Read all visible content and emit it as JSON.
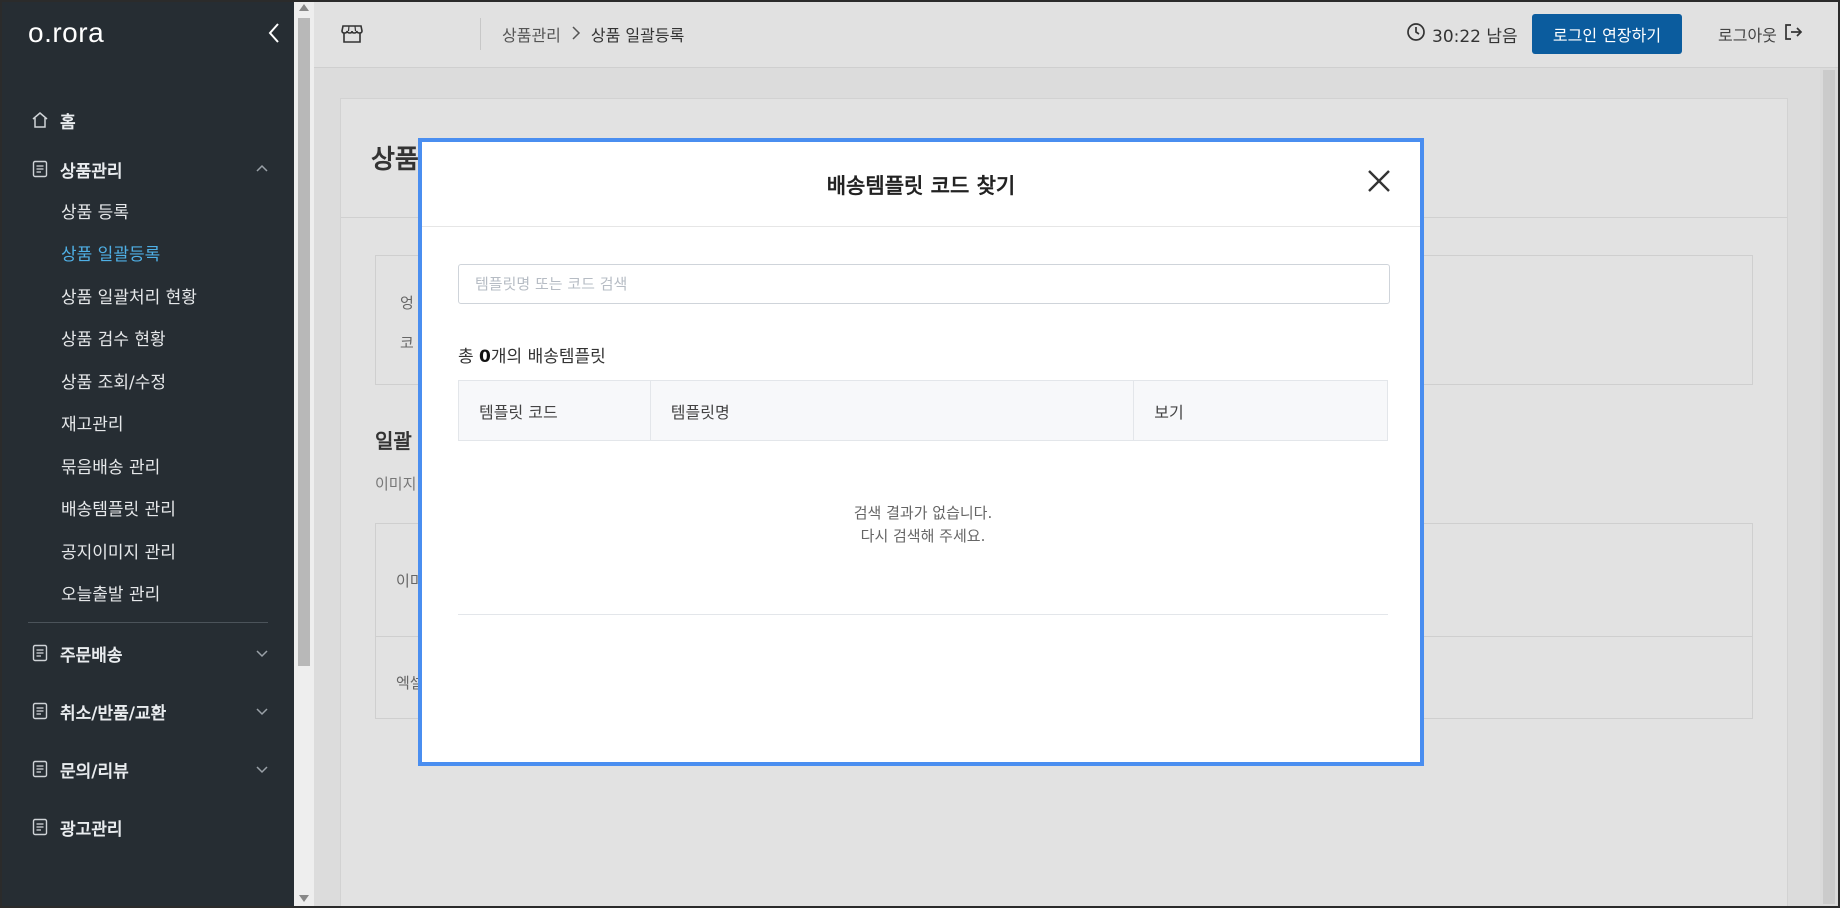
{
  "sidebar": {
    "logo": "o.rora",
    "home": "홈",
    "product_mgmt": {
      "label": "상품관리",
      "items": [
        "상품 등록",
        "상품 일괄등록",
        "상품 일괄처리 현황",
        "상품 검수 현황",
        "상품 조회/수정",
        "재고관리",
        "묶음배송 관리",
        "배송템플릿 관리",
        "공지이미지 관리",
        "오늘출발 관리"
      ],
      "active_index": 1
    },
    "order_delivery": "주문배송",
    "cancel_return": "취소/반품/교환",
    "inquiry_review": "문의/리뷰",
    "ad_mgmt": "광고관리",
    "active_color": "#4fb0e6"
  },
  "header": {
    "breadcrumb_parent": "상품관리",
    "breadcrumb_sep": ">",
    "breadcrumb_current": "상품 일괄등록",
    "timer": "30:22 남음",
    "extend_button": "로그인 연장하기",
    "logout": "로그아웃",
    "accent": "#0b5c9e"
  },
  "background_page": {
    "title_fragment": "상품",
    "info_line1": "엉",
    "info_line2": "코",
    "section_title": "일괄",
    "section_desc": "이미지",
    "row1": "이미",
    "row2": "엑셀"
  },
  "modal": {
    "title": "배송템플릿 코드 찾기",
    "search_placeholder": "템플릿명 또는 코드 검색",
    "count_prefix": "총 ",
    "count_value": "0",
    "count_suffix": "개의 배송템플릿",
    "columns": [
      "템플릿 코드",
      "템플릿명",
      "보기"
    ],
    "empty_line1": "검색 결과가 없습니다.",
    "empty_line2": "다시 검색해 주세요.",
    "border_color": "#4a8ef0"
  }
}
